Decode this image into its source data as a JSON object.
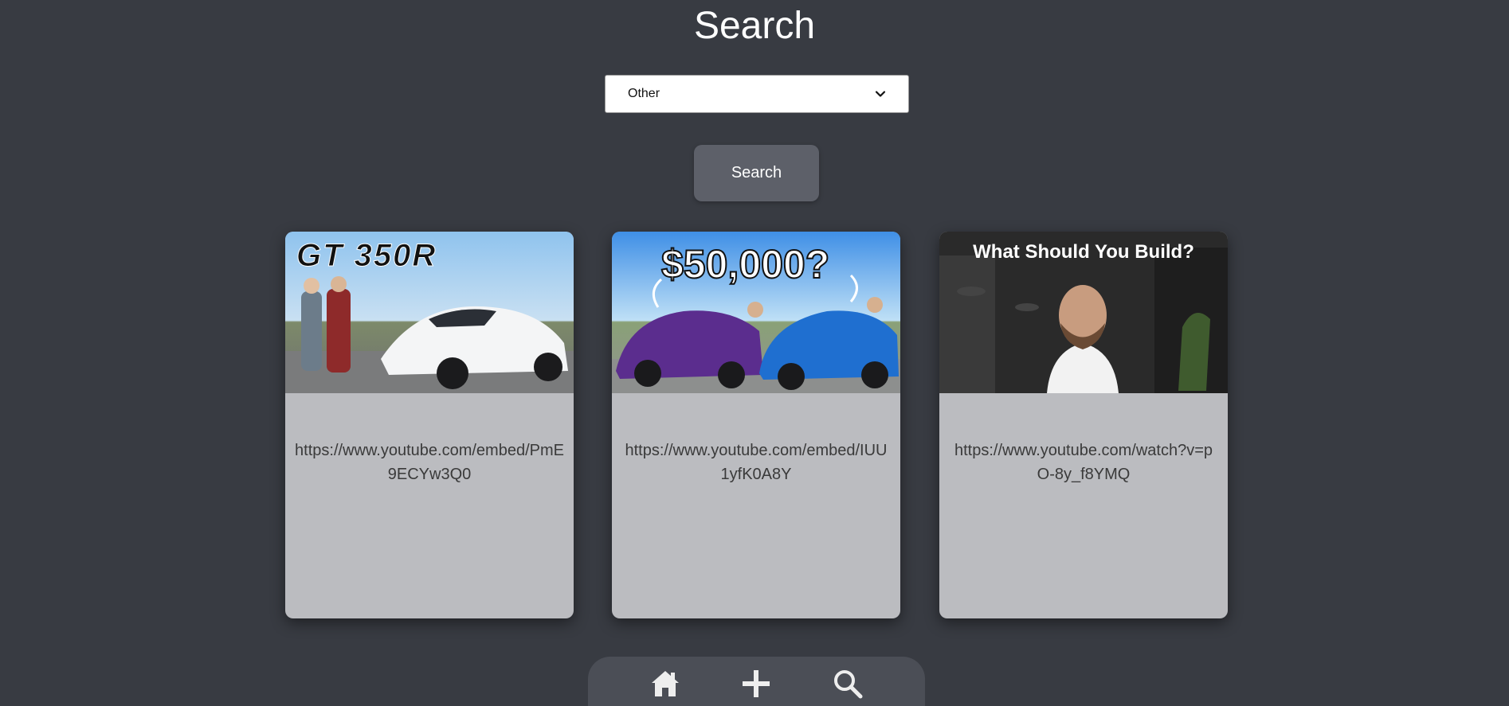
{
  "header": {
    "title": "Search"
  },
  "filter": {
    "selected_category": "Other"
  },
  "search_button": {
    "label": "Search"
  },
  "results": [
    {
      "thumbnail_text": "GT 350R",
      "url": "https://www.youtube.com/embed/PmE9ECYw3Q0"
    },
    {
      "thumbnail_text": "$50,000?",
      "url": "https://www.youtube.com/embed/IUU1yfK0A8Y"
    },
    {
      "thumbnail_text": "What Should You Build?",
      "url": "https://www.youtube.com/watch?v=pO-8y_f8YMQ"
    }
  ],
  "bottom_nav": {
    "items": [
      {
        "icon": "home-icon"
      },
      {
        "icon": "plus-icon"
      },
      {
        "icon": "search-icon"
      }
    ]
  },
  "colors": {
    "background": "#383b42",
    "card": "#bbbcc0",
    "button": "#5d6069",
    "nav": "#4b4e56"
  }
}
